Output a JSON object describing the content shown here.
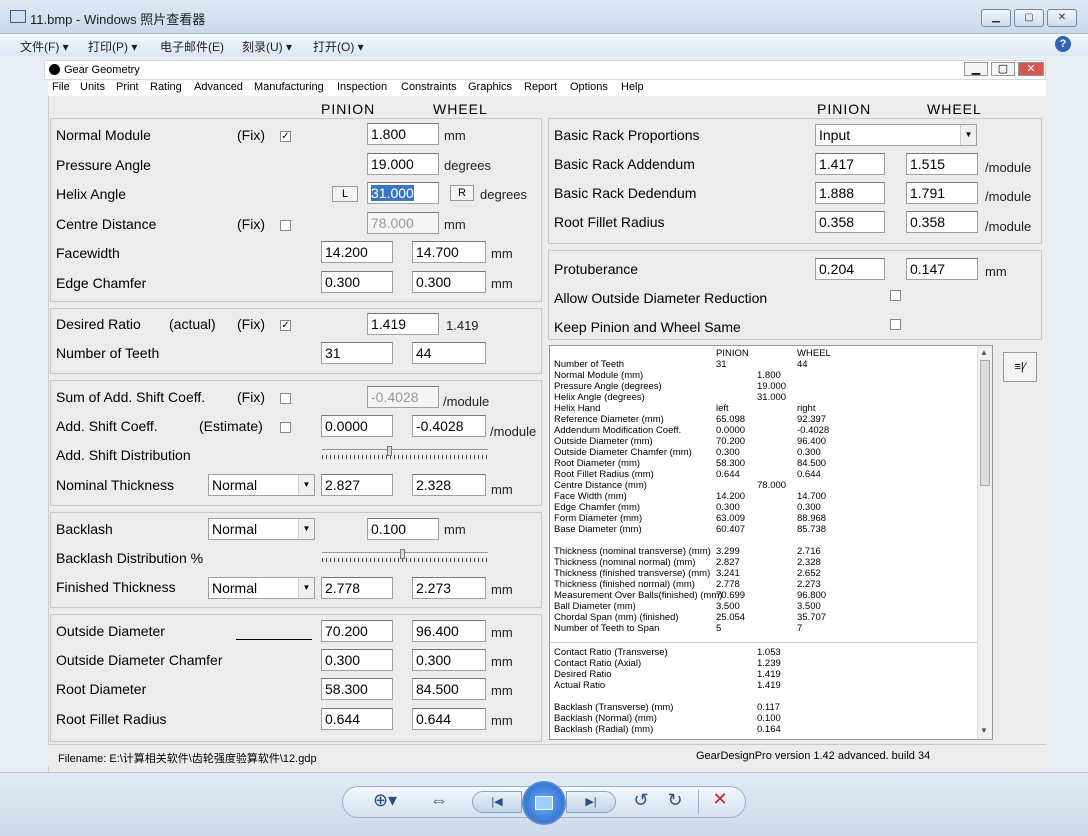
{
  "window": {
    "title": "11.bmp - Windows 照片查看器",
    "menu": [
      "文件(F)",
      "打印(P)",
      "电子邮件(E)",
      "刻录(U)",
      "打开(O)"
    ]
  },
  "app": {
    "title": "Gear Geometry",
    "menu": [
      "File",
      "Units",
      "Print",
      "Rating",
      "Advanced",
      "Manufacturing",
      "Inspection",
      "Constraints",
      "Graphics",
      "Report",
      "Options",
      "Help"
    ]
  },
  "headers": {
    "pinion": "PINION",
    "wheel": "WHEEL"
  },
  "left": {
    "normal_module": {
      "label": "Normal Module",
      "fix": "(Fix)",
      "value": "1.800",
      "unit": "mm"
    },
    "pressure_angle": {
      "label": "Pressure Angle",
      "value": "19.000",
      "unit": "degrees"
    },
    "helix_angle": {
      "label": "Helix Angle",
      "l": "L",
      "value": "31.000",
      "r": "R",
      "unit": "degrees"
    },
    "centre_distance": {
      "label": "Centre Distance",
      "fix": "(Fix)",
      "value": "78.000",
      "unit": "mm"
    },
    "facewidth": {
      "label": "Facewidth",
      "pinion": "14.200",
      "wheel": "14.700",
      "unit": "mm"
    },
    "edge_chamfer": {
      "label": "Edge Chamfer",
      "pinion": "0.300",
      "wheel": "0.300",
      "unit": "mm"
    },
    "desired_ratio": {
      "label": "Desired Ratio",
      "actual": "(actual)",
      "fix": "(Fix)",
      "value": "1.419",
      "actual_value": "1.419"
    },
    "teeth": {
      "label": "Number of Teeth",
      "pinion": "31",
      "wheel": "44"
    },
    "sum_shift": {
      "label": "Sum of Add. Shift Coeff.",
      "fix": "(Fix)",
      "value": "-0.4028",
      "unit": "/module"
    },
    "add_shift": {
      "label": "Add. Shift Coeff.",
      "estimate": "(Estimate)",
      "pinion": "0.0000",
      "wheel": "-0.4028",
      "unit": "/module"
    },
    "shift_dist": {
      "label": "Add. Shift Distribution"
    },
    "nominal_thickness": {
      "label": "Nominal Thickness",
      "select": "Normal",
      "pinion": "2.827",
      "wheel": "2.328",
      "unit": "mm"
    },
    "backlash": {
      "label": "Backlash",
      "select": "Normal",
      "value": "0.100",
      "unit": "mm"
    },
    "backlash_dist": {
      "label": "Backlash Distribution %"
    },
    "finished_thickness": {
      "label": "Finished Thickness",
      "select": "Normal",
      "pinion": "2.778",
      "wheel": "2.273",
      "unit": "mm"
    },
    "outside_diameter": {
      "label": "Outside Diameter",
      "pinion": "70.200",
      "wheel": "96.400",
      "unit": "mm"
    },
    "od_chamfer": {
      "label": "Outside Diameter Chamfer",
      "pinion": "0.300",
      "wheel": "0.300",
      "unit": "mm"
    },
    "root_diameter": {
      "label": "Root Diameter",
      "pinion": "58.300",
      "wheel": "84.500",
      "unit": "mm"
    },
    "root_fillet": {
      "label": "Root Fillet Radius",
      "pinion": "0.644",
      "wheel": "0.644",
      "unit": "mm"
    }
  },
  "right": {
    "rack_props": {
      "label": "Basic Rack Proportions",
      "select": "Input"
    },
    "rack_add": {
      "label": "Basic Rack Addendum",
      "pinion": "1.417",
      "wheel": "1.515",
      "unit": "/module"
    },
    "rack_ded": {
      "label": "Basic Rack Dedendum",
      "pinion": "1.888",
      "wheel": "1.791",
      "unit": "/module"
    },
    "root_fillet": {
      "label": "Root Fillet Radius",
      "pinion": "0.358",
      "wheel": "0.358",
      "unit": "/module"
    },
    "protuberance": {
      "label": "Protuberance",
      "pinion": "0.204",
      "wheel": "0.147",
      "unit": "mm"
    },
    "allow_od": {
      "label": "Allow Outside Diameter Reduction"
    },
    "keep_same": {
      "label": "Keep Pinion and Wheel Same"
    }
  },
  "report": {
    "header": [
      "PINION",
      "WHEEL"
    ],
    "rows": [
      [
        "Number of Teeth",
        "31",
        "",
        "44"
      ],
      [
        "Normal Module (mm)",
        "",
        "1.800",
        ""
      ],
      [
        "Pressure Angle (degrees)",
        "",
        "19.000",
        ""
      ],
      [
        "Helix Angle (degrees)",
        "",
        "31.000",
        ""
      ],
      [
        "Helix Hand",
        "left",
        "",
        "right"
      ],
      [
        "Reference Diameter (mm)",
        "65.098",
        "",
        "92.397"
      ],
      [
        "Addendum Modification Coeff.",
        "0.0000",
        "",
        "-0.4028"
      ],
      [
        "Outside Diameter (mm)",
        "70.200",
        "",
        "96.400"
      ],
      [
        "Outside Diameter Chamfer (mm)",
        "0.300",
        "",
        "0.300"
      ],
      [
        "Root Diameter (mm)",
        "58.300",
        "",
        "84.500"
      ],
      [
        "Root Fillet Radius (mm)",
        "0.644",
        "",
        "0.644"
      ],
      [
        "Centre Distance (mm)",
        "",
        "78.000",
        ""
      ],
      [
        "Face Width (mm)",
        "14.200",
        "",
        "14.700"
      ],
      [
        "Edge Chamfer (mm)",
        "0.300",
        "",
        "0.300"
      ],
      [
        "Form Diameter (mm)",
        "63.009",
        "",
        "88.968"
      ],
      [
        "Base Diameter (mm)",
        "60.407",
        "",
        "85.738"
      ],
      [
        "",
        "",
        "",
        ""
      ],
      [
        "Thickness (nominal transverse) (mm)",
        "3.299",
        "",
        "2.716"
      ],
      [
        "Thickness (nominal normal) (mm)",
        "2.827",
        "",
        "2.328"
      ],
      [
        "Thickness (finished transverse) (mm)",
        "3.241",
        "",
        "2.652"
      ],
      [
        "Thickness (finished normal) (mm)",
        "2.778",
        "",
        "2.273"
      ],
      [
        "Measurement Over Balls(finished) (mm)",
        "70.699",
        "",
        "96.800"
      ],
      [
        "Ball Diameter (mm)",
        "3.500",
        "",
        "3.500"
      ],
      [
        "Chordal Span (mm) (finished)",
        "25.054",
        "",
        "35.707"
      ],
      [
        "Number of Teeth to Span",
        "5",
        "",
        "7"
      ]
    ],
    "rows2": [
      [
        "Contact Ratio (Transverse)",
        "1.053"
      ],
      [
        "Contact Ratio (Axial)",
        "1.239"
      ],
      [
        "Desired Ratio",
        "1.419"
      ],
      [
        "Actual Ratio",
        "1.419"
      ],
      [
        "",
        ""
      ],
      [
        "Backlash (Transverse) (mm)",
        "0.117"
      ],
      [
        "Backlash (Normal) (mm)",
        "0.100"
      ],
      [
        "Backlash (Radial) (mm)",
        "0.164"
      ]
    ]
  },
  "status": {
    "filename": "Filename: E:\\计算相关软件\\齿轮强度验算软件\\12.gdp",
    "version": "GearDesignPro version 1.42 advanced. build 34"
  }
}
